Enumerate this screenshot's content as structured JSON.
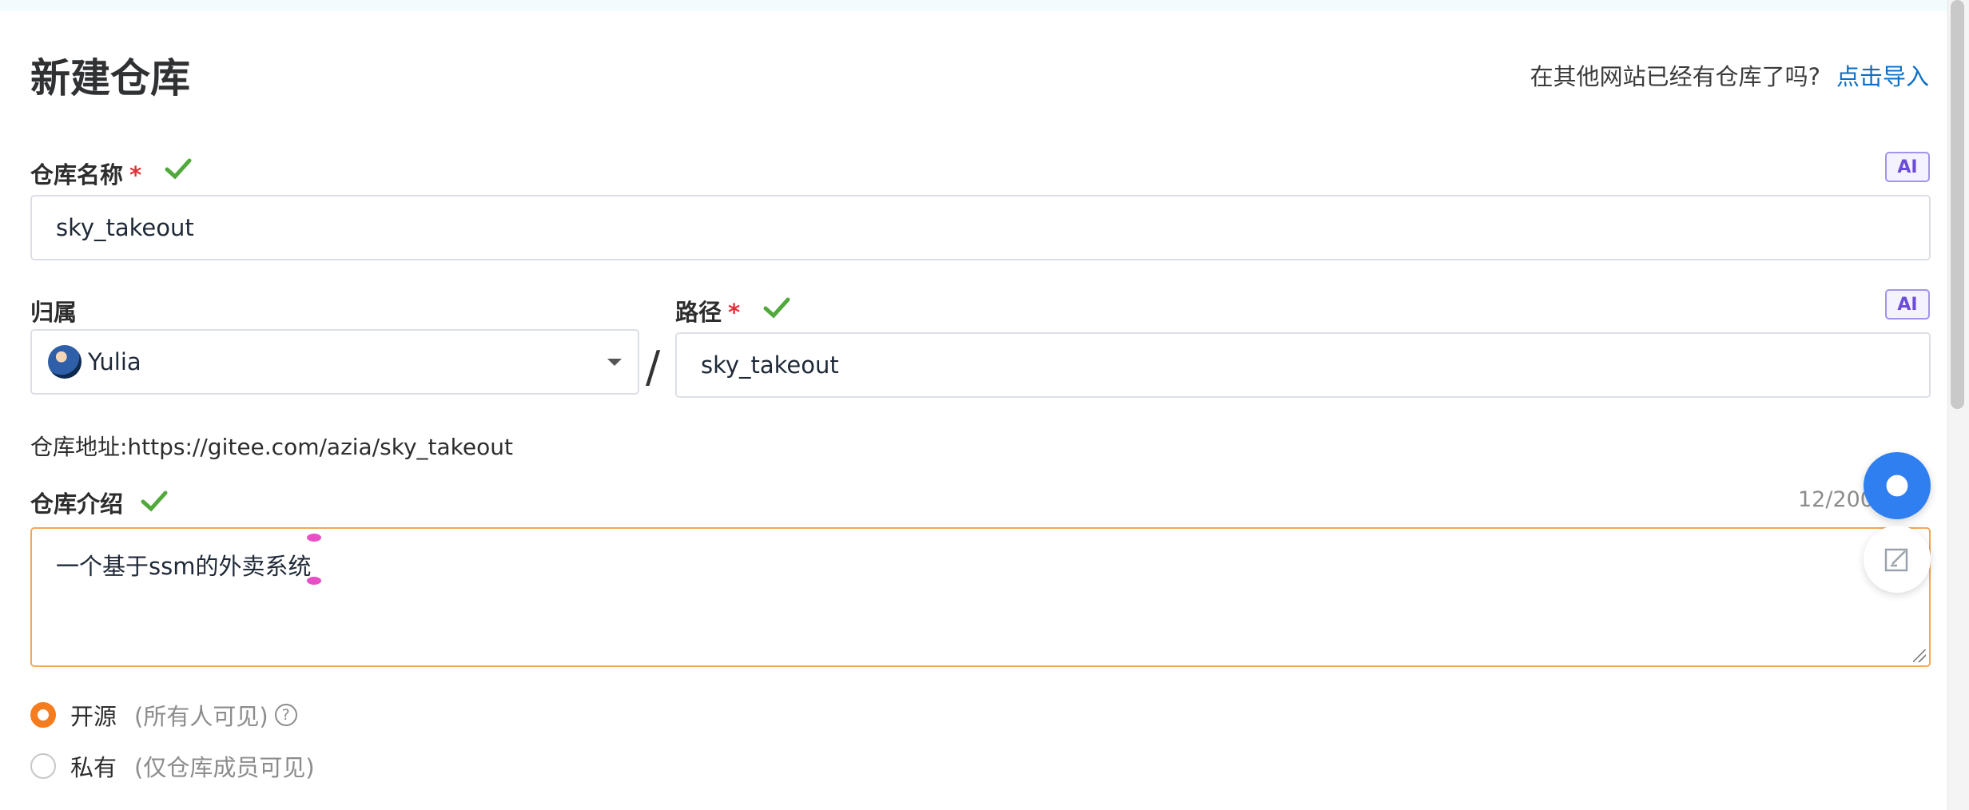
{
  "page": {
    "title": "新建仓库"
  },
  "import": {
    "question": "在其他网站已经有仓库了吗?",
    "link": "点击导入"
  },
  "repo_name": {
    "label": "仓库名称",
    "required_mark": "*",
    "value": "sky_takeout",
    "ai_badge": "AI"
  },
  "owner": {
    "label": "归属",
    "value": "Yulia"
  },
  "separator": "/",
  "path": {
    "label": "路径",
    "required_mark": "*",
    "value": "sky_takeout",
    "ai_badge": "AI"
  },
  "repo_address": {
    "text": "仓库地址:https://gitee.com/azia/sky_takeout"
  },
  "description": {
    "label": "仓库介绍",
    "value": "一个基于ssm的外卖系统",
    "counter": "12/200"
  },
  "visibility": {
    "options": [
      {
        "label": "开源",
        "hint": "(所有人可见)",
        "checked": true
      },
      {
        "label": "私有",
        "hint": "(仅仓库成员可见)",
        "checked": false
      }
    ],
    "help": "?"
  },
  "colors": {
    "accent": "#f57c1f",
    "link": "#0c6ec3",
    "check": "#52a93b",
    "focus_border": "#f2a65a"
  }
}
